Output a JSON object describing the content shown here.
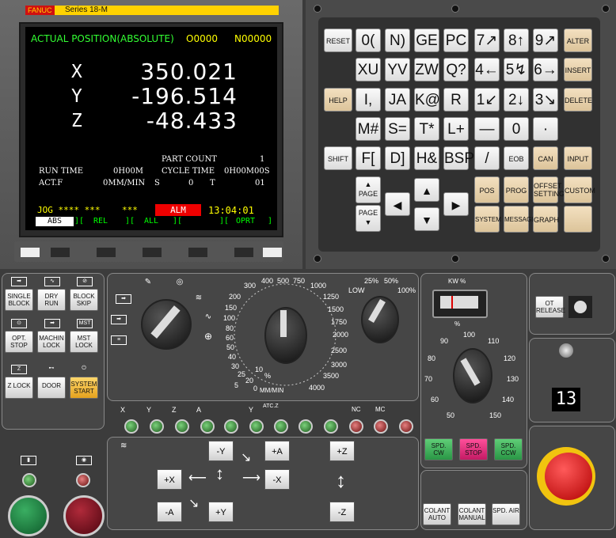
{
  "brand": {
    "logo": "FANUC",
    "series": "Series 18-M"
  },
  "lcd": {
    "title": "ACTUAL POSITION(ABSOLUTE)",
    "prog_o": "O0000",
    "prog_n": "N00000",
    "axes": [
      {
        "label": "X",
        "value": "350.021"
      },
      {
        "label": "Y",
        "value": "-196.514"
      },
      {
        "label": "Z",
        "value": "-48.433"
      }
    ],
    "part_count_label": "PART COUNT",
    "part_count": "1",
    "run_time_label": "RUN TIME",
    "run_time": "0H00M",
    "cycle_time_label": "CYCLE TIME",
    "cycle_time": "0H00M00S",
    "actf_label": "ACT.F",
    "actf": "0MM/MIN",
    "s_label": "S",
    "s_value": "0",
    "t_label": "T",
    "t_value": "01",
    "mode": "JOG **** ***",
    "stars": "***",
    "alarm": "ALM",
    "clock": "13:04:01",
    "softkeys": [
      "ABS",
      "REL",
      "ALL",
      "",
      "OPRT"
    ]
  },
  "keypad": {
    "reset": "RESET",
    "rows": [
      [
        "0(",
        "N)",
        "GE",
        "PC",
        "7↗",
        "8↑",
        "9↗",
        "ALTER"
      ],
      [
        "XU",
        "YV",
        "ZW",
        "Q?",
        "4←",
        "5↯",
        "6→",
        "INSERT"
      ],
      [
        "HELP",
        "I,",
        "JA",
        "K@",
        "R",
        "1↙",
        "2↓",
        "3↘",
        "DELETE"
      ],
      [
        "M#",
        "S=",
        "T*",
        "L+",
        "—",
        "0",
        "·"
      ],
      [
        "SHIFT",
        "F[",
        "D]",
        "H&",
        "BSP",
        "/",
        "EOB",
        "CAN",
        "INPUT"
      ]
    ],
    "page_up": "PAGE",
    "page_down": "PAGE",
    "func": [
      "POS",
      "PROG",
      "OFFSET SETTING",
      "CUSTOM",
      "SYSTEM",
      "MESSAGE",
      "GRAPH"
    ]
  },
  "left_buttons": [
    "SINGLE BLOCK",
    "DRY RUN",
    "BLOCK SKIP",
    "OPT. STOP",
    "MACHIN LOCK",
    "MST LOCK",
    "Z LOCK",
    "DOOR",
    "SYSTEM START"
  ],
  "feed_dial": {
    "labels": [
      "300",
      "400",
      "500",
      "750",
      "1000",
      "1250",
      "1500",
      "1750",
      "2000",
      "2500",
      "3000",
      "3500",
      "4000",
      "200",
      "150",
      "100",
      "80",
      "60",
      "50",
      "40",
      "30",
      "25",
      "20",
      "10",
      "5",
      "2",
      "0",
      "%"
    ],
    "unit": "MM/MIN"
  },
  "spindle_override_top": {
    "labels": [
      "LOW",
      "25%",
      "50%",
      "100%"
    ]
  },
  "axis_select": [
    "X",
    "Y",
    "Z",
    "A",
    "",
    "Y",
    "ATC.Z",
    "",
    "",
    "NC",
    "MC"
  ],
  "jog_buttons": {
    "minus_y": "-Y",
    "plus_a": "+A",
    "plus_z": "+Z",
    "plus_x": "+X",
    "minus_x": "-X",
    "minus_a": "-A",
    "plus_y": "+Y",
    "minus_z": "-Z"
  },
  "spindle_load": {
    "label": "KW %",
    "percent_label": "%",
    "override": [
      "50",
      "60",
      "70",
      "80",
      "90",
      "100",
      "110",
      "120",
      "130",
      "140",
      "150"
    ]
  },
  "spindle_buttons": [
    "SPD. CW",
    "SPD. STOP",
    "SPD. CCW"
  ],
  "coolant_buttons": [
    "COLANT AUTO",
    "COLANT MANUAL",
    "SPD. AIR"
  ],
  "ot_release": "OT RELEASE",
  "tool_display": "13"
}
